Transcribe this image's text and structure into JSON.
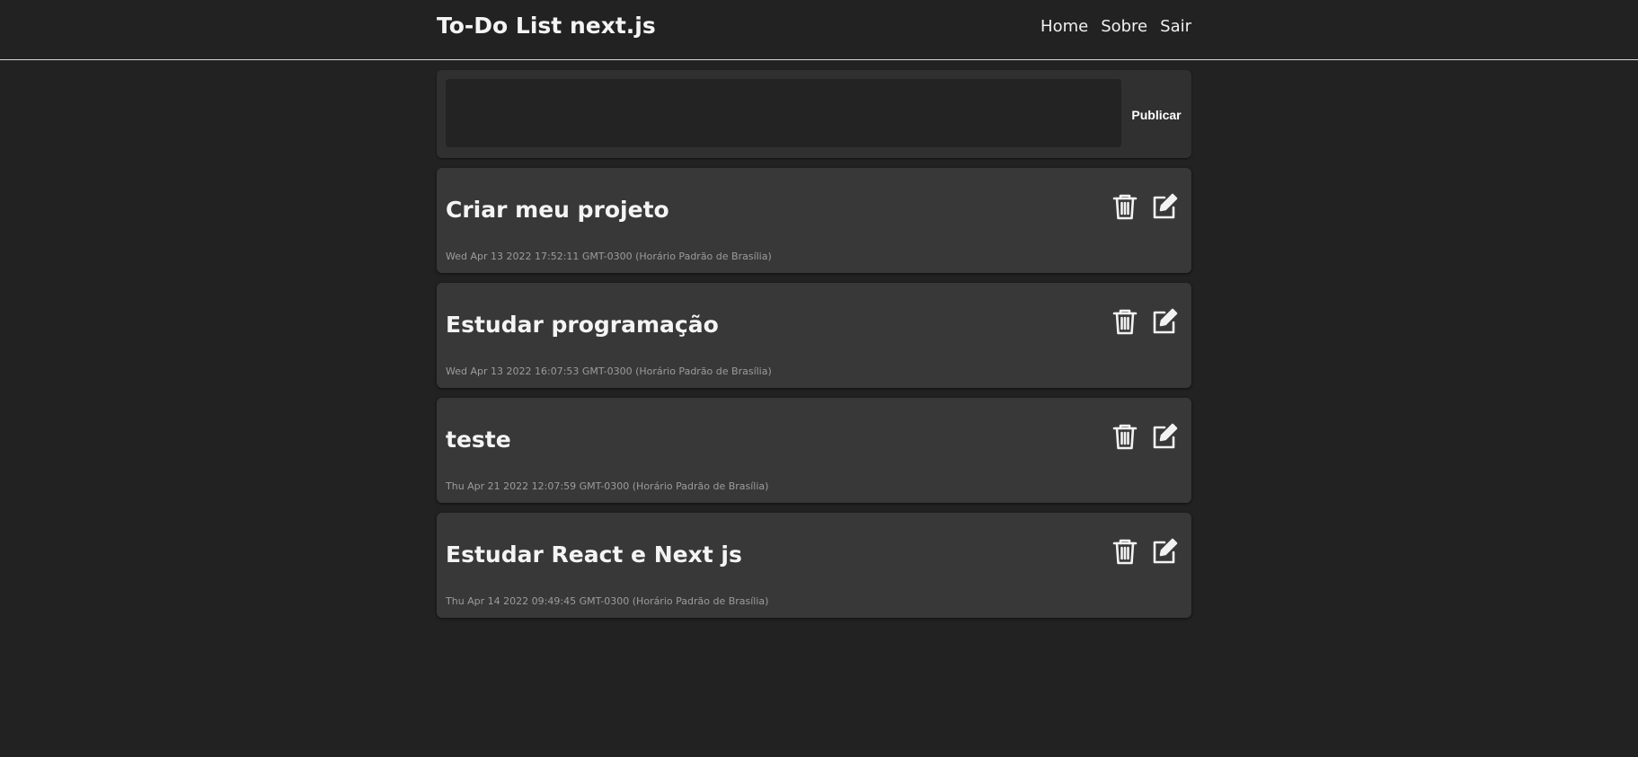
{
  "header": {
    "title": "To-Do List next.js",
    "nav": [
      {
        "label": "Home"
      },
      {
        "label": "Sobre"
      },
      {
        "label": "Sair"
      }
    ]
  },
  "composer": {
    "value": "",
    "publish_label": "Publicar"
  },
  "tasks": [
    {
      "title": "Criar meu projeto",
      "date": "Wed Apr 13 2022 17:52:11 GMT-0300 (Horário Padrão de Brasília)"
    },
    {
      "title": "Estudar programação",
      "date": "Wed Apr 13 2022 16:07:53 GMT-0300 (Horário Padrão de Brasília)"
    },
    {
      "title": "teste",
      "date": "Thu Apr 21 2022 12:07:59 GMT-0300 (Horário Padrão de Brasília)"
    },
    {
      "title": "Estudar React e Next js",
      "date": "Thu Apr 14 2022 09:49:45 GMT-0300 (Horário Padrão de Brasília)"
    }
  ],
  "icons": {
    "delete": "trash-icon",
    "edit": "edit-icon"
  },
  "colors": {
    "background": "#222222",
    "card": "#383838",
    "composer": "#303030",
    "text": "#f4f4f4",
    "muted": "#9c9c9c"
  }
}
